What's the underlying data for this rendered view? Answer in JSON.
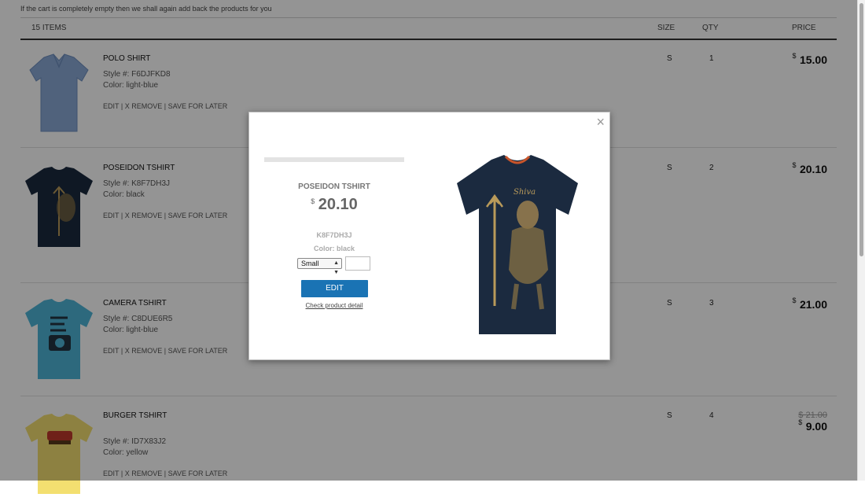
{
  "notice": "If the cart is completely empty then we shall again add back the products for you",
  "header": {
    "items": "15 ITEMS",
    "size": "SIZE",
    "qty": "QTY",
    "price": "PRICE"
  },
  "products": [
    {
      "name": "POLO SHIRT",
      "style": "Style #: F6DJFKD8",
      "color": "Color: light-blue",
      "size": "S",
      "qty": "1",
      "currency": "$",
      "price": "15.00",
      "old_price": "",
      "shirt_color": "#8aa9d6"
    },
    {
      "name": "POSEIDON TSHIRT",
      "style": "Style #: K8F7DH3J",
      "color": "Color: black",
      "size": "S",
      "qty": "2",
      "currency": "$",
      "price": "20.10",
      "old_price": "",
      "shirt_color": "#1b2a3f"
    },
    {
      "name": "CAMERA TSHIRT",
      "style": "Style #: C8DUE6R5",
      "color": "Color: light-blue",
      "size": "S",
      "qty": "3",
      "currency": "$",
      "price": "21.00",
      "old_price": "",
      "shirt_color": "#4fb6d8"
    },
    {
      "name": "BURGER TSHIRT",
      "style": "Style #: ID7X83J2",
      "color": "Color: yellow",
      "size": "S",
      "qty": "4",
      "currency": "$",
      "price": "9.00",
      "old_price": "$ 21.00",
      "shirt_color": "#f3df70"
    }
  ],
  "actions": {
    "edit": "EDIT",
    "remove": "X REMOVE",
    "save": "SAVE FOR LATER",
    "sep": "|"
  },
  "modal": {
    "close": "×",
    "name": "POSEIDON TSHIRT",
    "currency": "$",
    "price": "20.10",
    "style": "K8F7DH3J",
    "color": "Color: black",
    "size_selected": "Small",
    "qty_value": "",
    "edit_button": "EDIT",
    "detail_link": "Check product detail",
    "shirt_color": "#1b2a3f"
  }
}
